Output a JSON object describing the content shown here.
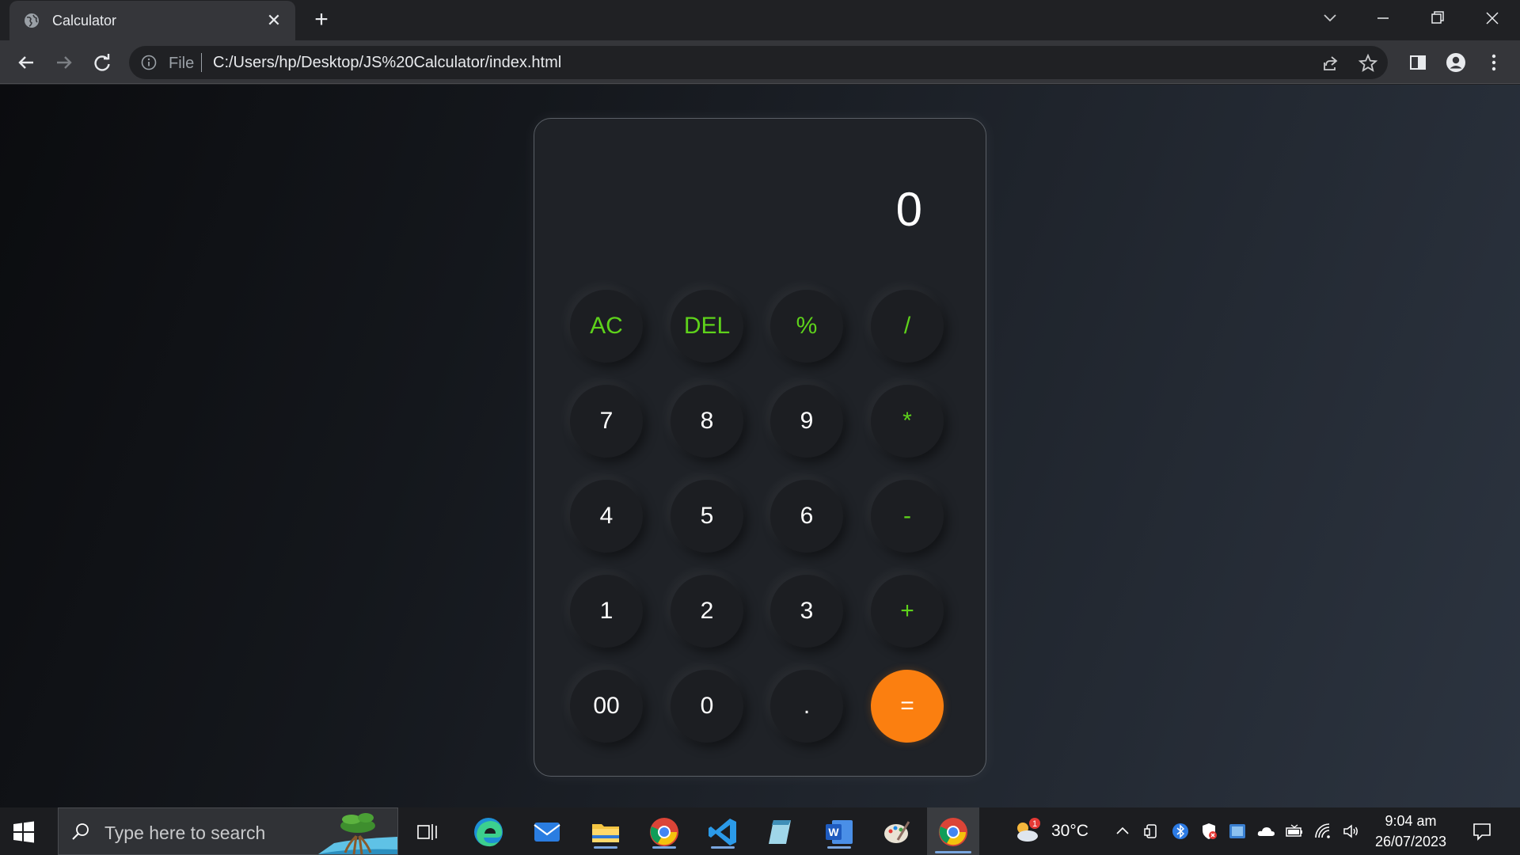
{
  "browser": {
    "tab_title": "Calculator",
    "file_label": "File",
    "url": "C:/Users/hp/Desktop/JS%20Calculator/index.html"
  },
  "calculator": {
    "display": "0",
    "keys": {
      "ac": "AC",
      "del": "DEL",
      "percent": "%",
      "divide": "/",
      "k7": "7",
      "k8": "8",
      "k9": "9",
      "multiply": "*",
      "k4": "4",
      "k5": "5",
      "k6": "6",
      "minus": "-",
      "k1": "1",
      "k2": "2",
      "k3": "3",
      "plus": "+",
      "k00": "00",
      "k0": "0",
      "dot": ".",
      "equals": "="
    },
    "colors": {
      "function_key": "#5ed21b",
      "equals_bg": "#fb7f10",
      "key_bg": "#1c1e22"
    }
  },
  "taskbar": {
    "search_placeholder": "Type here to search",
    "weather_temp": "30°C",
    "weather_badge": "1",
    "time": "9:04 am",
    "date": "26/07/2023"
  }
}
